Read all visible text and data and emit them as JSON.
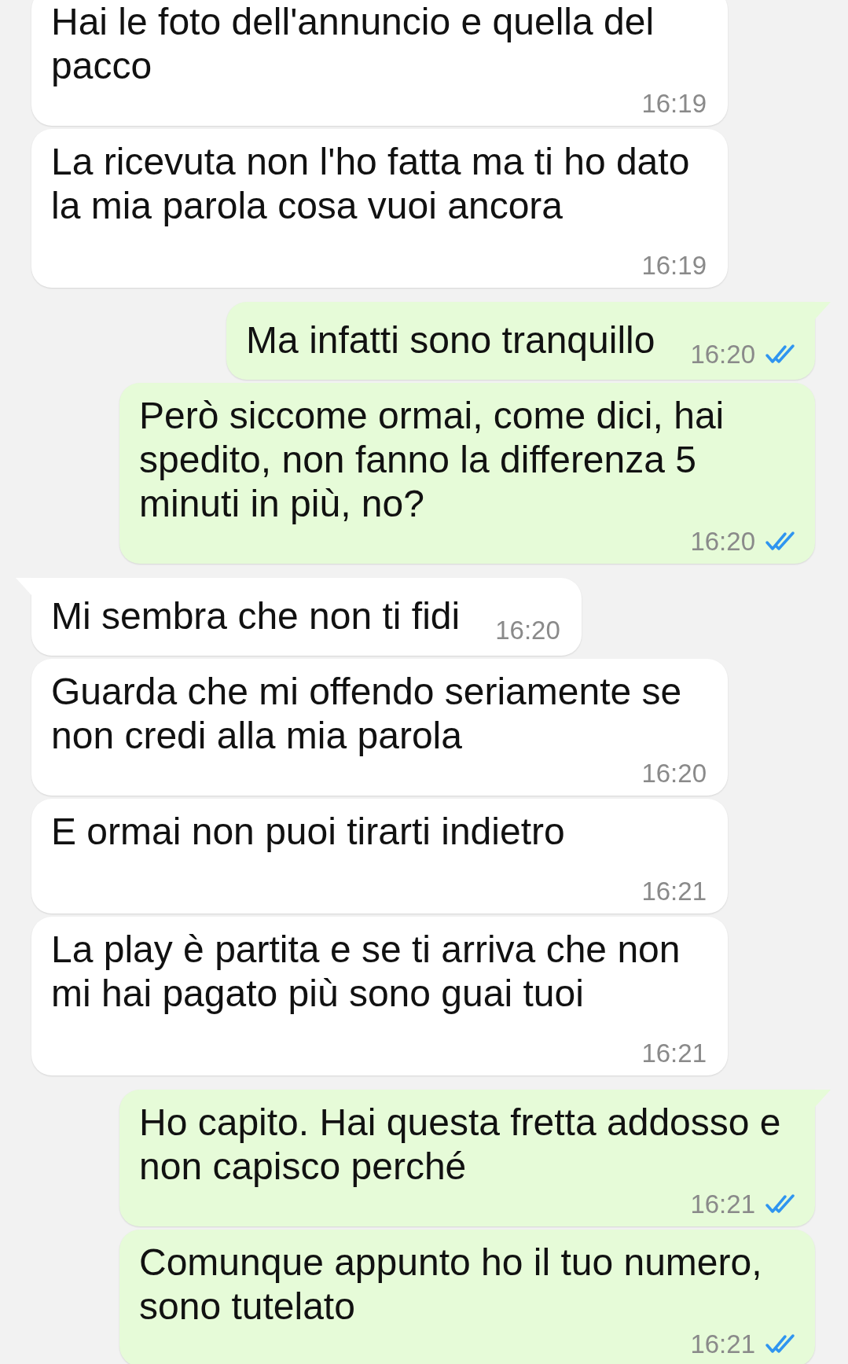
{
  "messages": [
    {
      "outgoing": false,
      "text": "Hai le foto dell'annuncio e quella del pacco",
      "time": "16:19"
    },
    {
      "outgoing": false,
      "text": "La ricevuta non l'ho fatta ma ti ho dato la mia parola cosa vuoi ancora",
      "time": "16:19"
    },
    {
      "outgoing": true,
      "text": "Ma infatti sono tranquillo",
      "time": "16:20",
      "read": true
    },
    {
      "outgoing": true,
      "text": "Però siccome ormai, come dici, hai spedito, non fanno la differenza 5 minuti in più, no?",
      "time": "16:20",
      "read": true
    },
    {
      "outgoing": false,
      "text": "Mi sembra che non ti fidi",
      "time": "16:20"
    },
    {
      "outgoing": false,
      "text": "Guarda che mi offendo seriamente se non credi alla mia parola",
      "time": "16:20"
    },
    {
      "outgoing": false,
      "text": "E ormai non puoi tirarti indietro",
      "time": "16:21"
    },
    {
      "outgoing": false,
      "text": "La play è partita e se ti arriva che non mi hai pagato più sono guai tuoi",
      "time": "16:21"
    },
    {
      "outgoing": true,
      "text": "Ho capito. Hai questa fretta addosso e non capisco perché",
      "time": "16:21",
      "read": true
    },
    {
      "outgoing": true,
      "text": "Comunque appunto ho il tuo numero, sono tutelato",
      "time": "16:21",
      "read": true
    }
  ]
}
